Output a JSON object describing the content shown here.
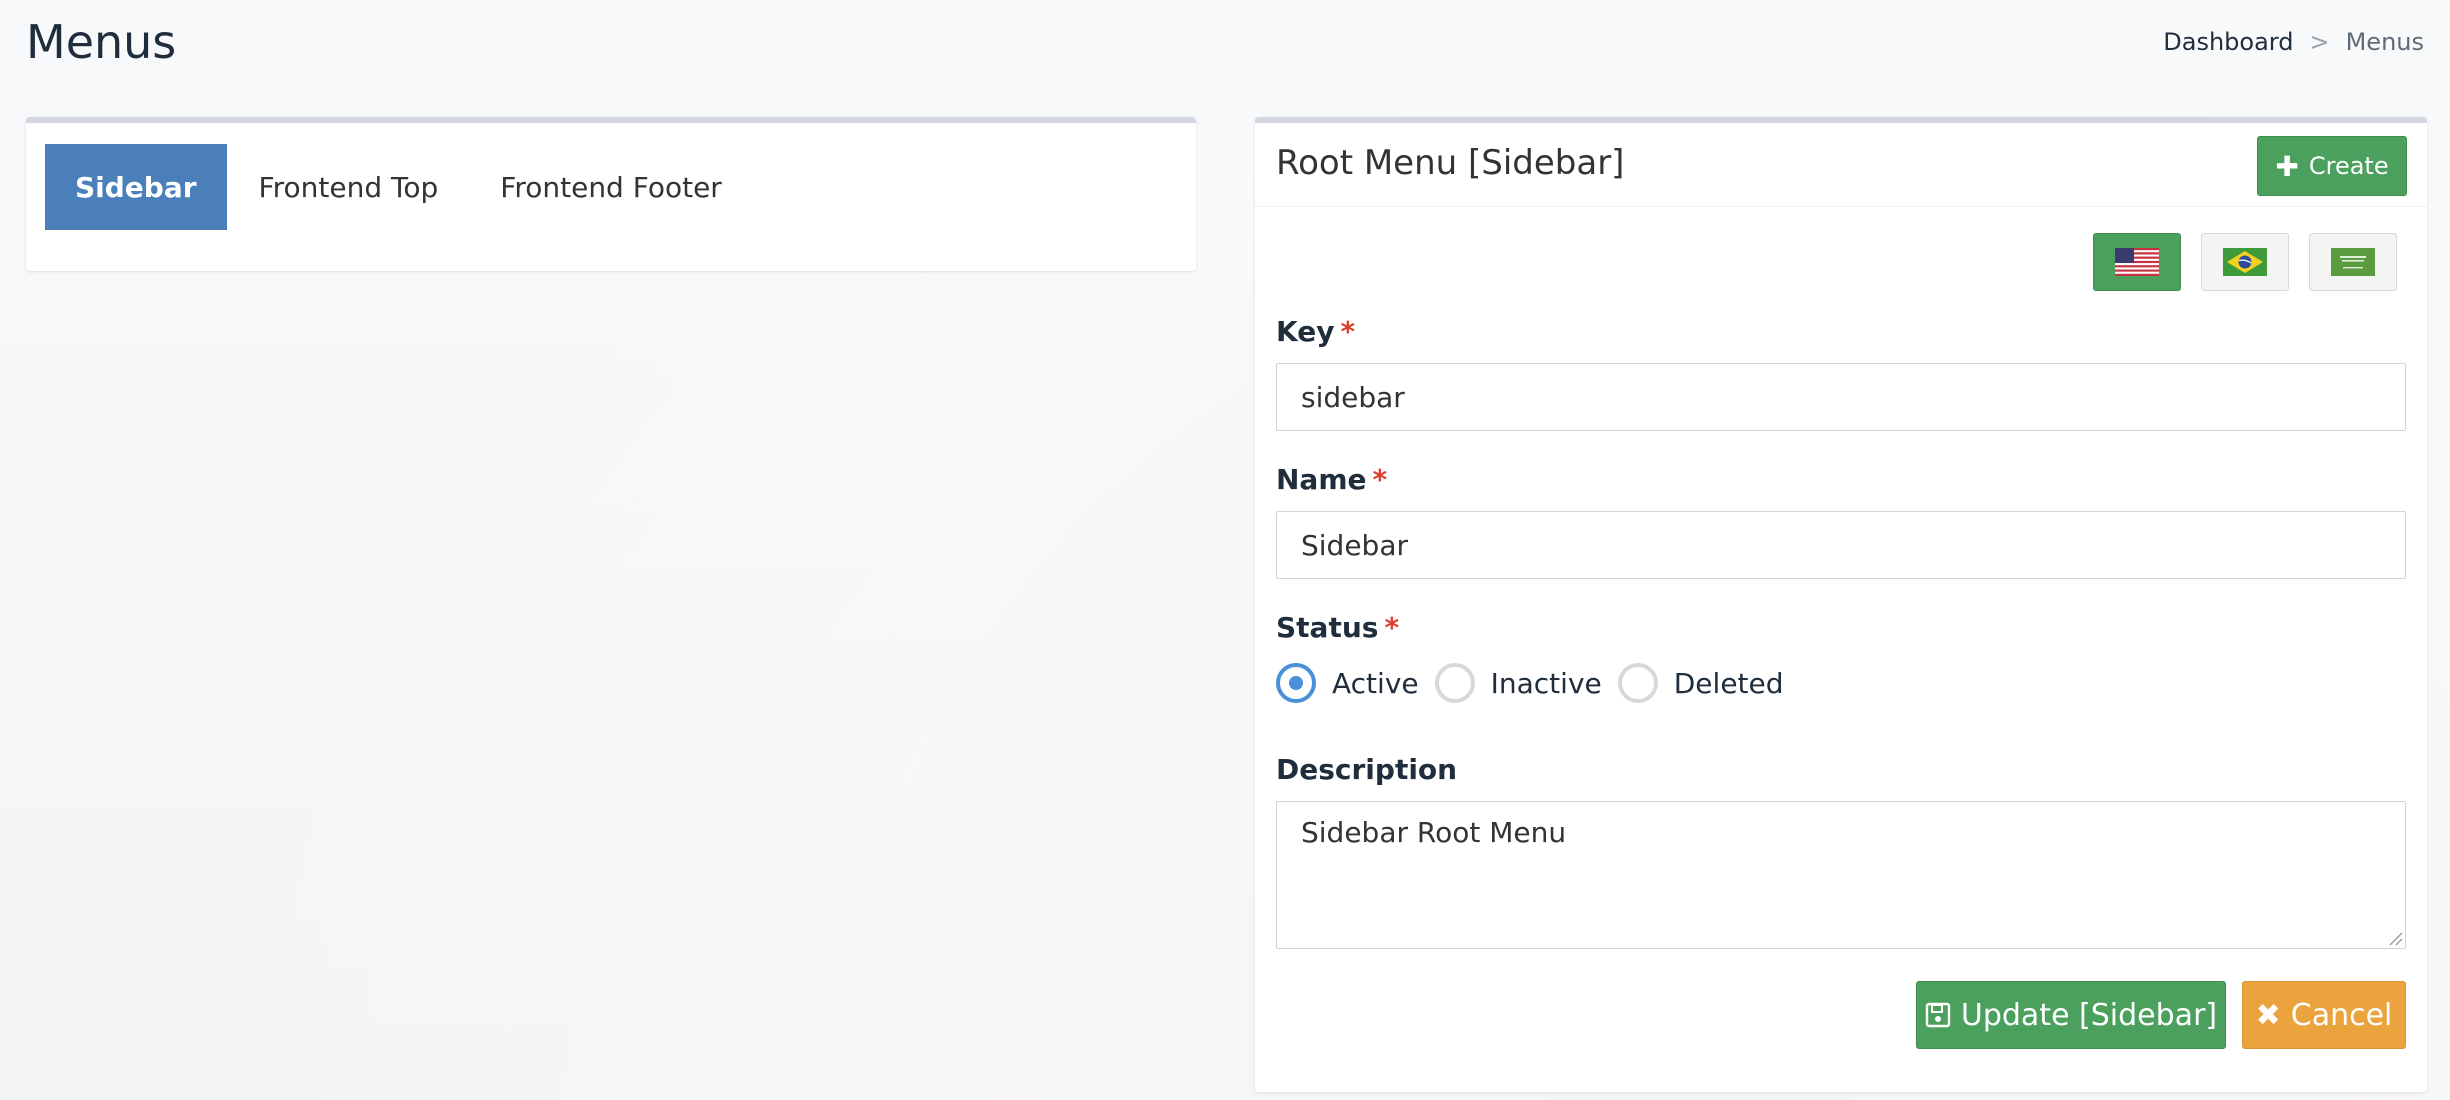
{
  "page": {
    "title": "Menus",
    "breadcrumb": {
      "home": "Dashboard",
      "separator": ">",
      "current": "Menus"
    }
  },
  "tabs": [
    {
      "label": "Sidebar",
      "active": true
    },
    {
      "label": "Frontend Top",
      "active": false
    },
    {
      "label": "Frontend Footer",
      "active": false
    }
  ],
  "form": {
    "title": "Root Menu [Sidebar]",
    "create_label": "Create",
    "languages": [
      {
        "icon": "us-flag-icon",
        "active": true
      },
      {
        "icon": "br-flag-icon",
        "active": false
      },
      {
        "icon": "sa-flag-icon",
        "active": false
      }
    ],
    "key": {
      "label": "Key",
      "required": "*",
      "value": "sidebar"
    },
    "name": {
      "label": "Name",
      "required": "*",
      "value": "Sidebar"
    },
    "status": {
      "label": "Status",
      "required": "*",
      "options": [
        "Active",
        "Inactive",
        "Deleted"
      ],
      "selected": "Active"
    },
    "description": {
      "label": "Description",
      "value": "Sidebar Root Menu"
    },
    "update_label": "Update [Sidebar]",
    "cancel_label": "Cancel"
  },
  "colors": {
    "tab_active": "#4a7fba",
    "success": "#4aa05c",
    "warning": "#eba33d",
    "required": "#dd3f2d",
    "radio_checked": "#4a90d9"
  }
}
